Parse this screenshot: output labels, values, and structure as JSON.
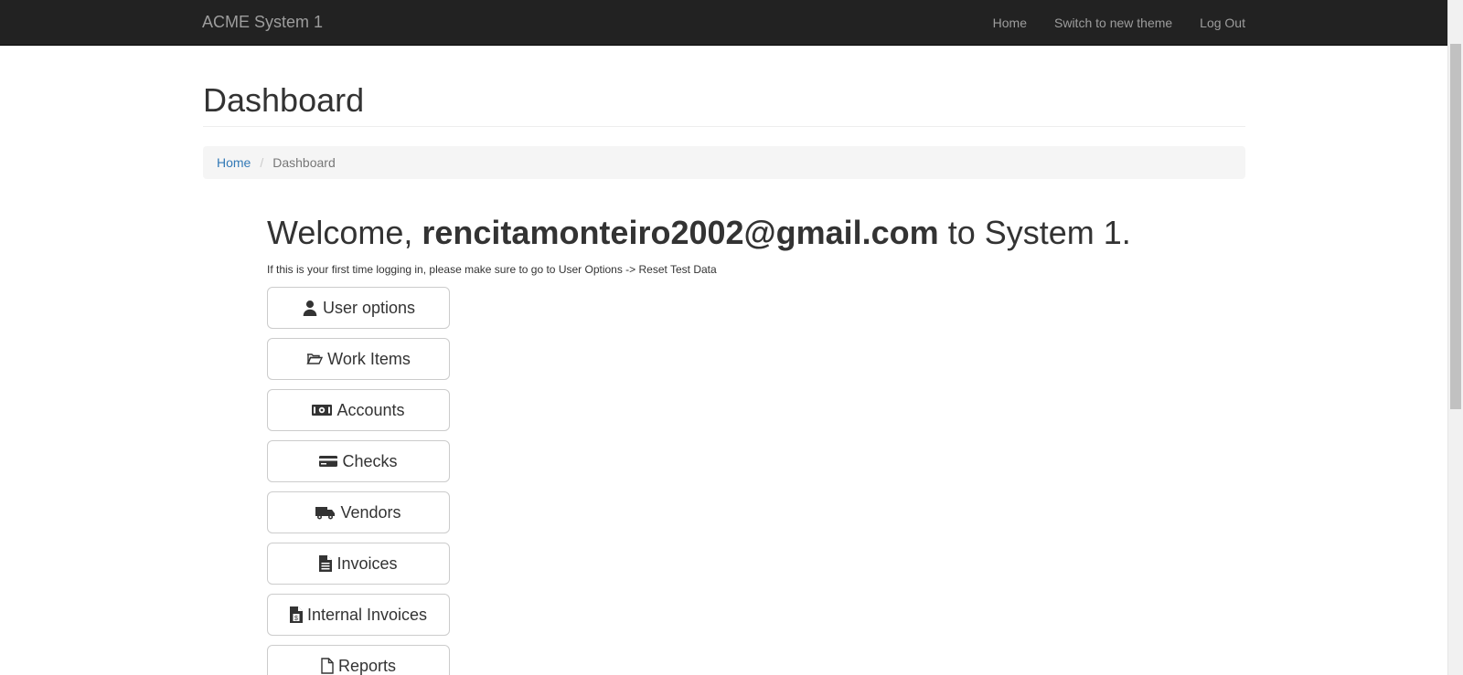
{
  "navbar": {
    "brand": "ACME System 1",
    "links": [
      "Home",
      "Switch to new theme",
      "Log Out"
    ]
  },
  "page": {
    "title": "Dashboard"
  },
  "breadcrumb": {
    "home": "Home",
    "separator": "/",
    "current": "Dashboard"
  },
  "welcome": {
    "prefix": "Welcome, ",
    "email": "rencitamonteiro2002@gmail.com",
    "suffix": " to System 1.",
    "hint": "If this is your first time logging in, please make sure to go to User Options -> Reset Test Data"
  },
  "menu": [
    {
      "label": "User options",
      "icon": "user-icon"
    },
    {
      "label": "Work Items",
      "icon": "folder-open-icon"
    },
    {
      "label": "Accounts",
      "icon": "money-icon"
    },
    {
      "label": "Checks",
      "icon": "credit-card-icon"
    },
    {
      "label": "Vendors",
      "icon": "truck-icon"
    },
    {
      "label": "Invoices",
      "icon": "file-text-icon"
    },
    {
      "label": "Internal Invoices",
      "icon": "file-invoice-dollar-icon"
    },
    {
      "label": "Reports",
      "icon": "file-icon"
    }
  ]
}
